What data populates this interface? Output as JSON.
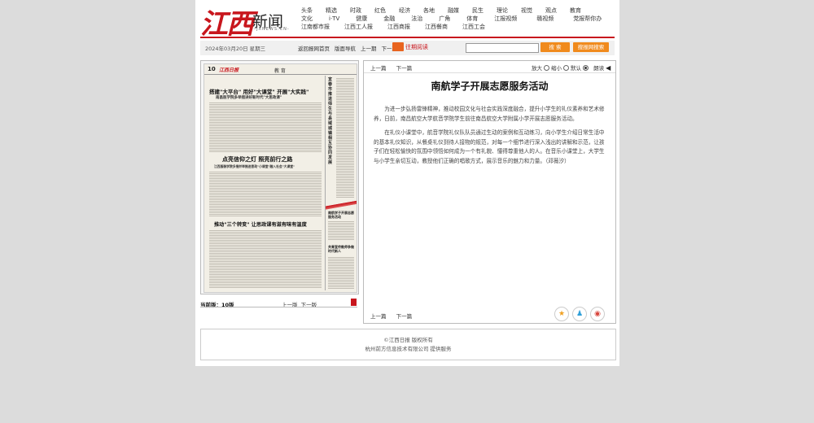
{
  "logo": {
    "cn": "江西",
    "xw": "新闻",
    "url": "-JXNEWS.CN-"
  },
  "nav": {
    "row1": [
      "头条",
      "精选",
      "时政",
      "红色",
      "经济",
      "各地",
      "融媒",
      "民生",
      "理论",
      "视觉",
      "观点",
      "教育"
    ],
    "row2": [
      "文化",
      "i·TV",
      "健康",
      "金融",
      "法治",
      "广角",
      "体育",
      "江报视频",
      "赣视频",
      "党报帮你办"
    ],
    "row3": [
      "江南都市报",
      "江西工人报",
      "江西商报",
      "江西餐商",
      "江西工会"
    ]
  },
  "toolbar": {
    "date": "2024年03月20日 星期三",
    "links": [
      "返回报网首页",
      "版面导航",
      "上一期",
      "下一期"
    ],
    "past_reading": "往期阅读",
    "search_btn": "搜 索",
    "search_site_btn": "搜报网搜索"
  },
  "paper": {
    "page_no": "10",
    "brand": "江西日报",
    "section": "教 育",
    "headline1": "搭建\"大平台\" 用好\"大课堂\" 开展\"大实践\"",
    "sub1": "南昌医学院多举措讲好新时代\"大思政课\"",
    "headline2": "点亮信仰之灯 照亮前行之路",
    "sub2": "江西服装学院多措并举推进思政\"小课堂\"融入社会\"大课堂\"",
    "headline3": "推动\"三个转变\" 让思政课有滋有味有温度",
    "vertical": "宜春市推进师生与县域城镇相互协同发展",
    "small1": "南航学子开展志愿服务活动",
    "small2": "共青宣传教师争做时代新人"
  },
  "edition": {
    "label": "当前版：",
    "value": "10版",
    "prev": "上一版",
    "next": "下一版"
  },
  "article": {
    "prev": "上一篇",
    "next": "下一篇",
    "font_label": "放大",
    "font_small": "缩小",
    "font_default": "默认",
    "read": "朗读",
    "title": "南航学子开展志愿服务活动",
    "p1": "为进一步弘扬雷锋精神，推动校园文化与社会实践深度融合，提升小学生的礼仪素养和艺术修养，日前，南昌航空大学航音学院学生前往南昌航空大学附属小学开展志愿服务活动。",
    "p2": "在礼仪小课堂中，航音学院礼仪队队员通过生动的案例和互动练习，向小学生介绍日常生活中的基本礼仪知识，从餐桌礼仪到待人接物的规范，对每一个细节进行深入浅出的讲解和示范，让孩子们在轻松愉快的氛围中领悟如何成为一个有礼貌、懂得尊重他人的人。在音乐小课堂上，大学生与小学生亲切互动，教授他们正确的唱歌方式，展示音乐的魅力和力量。（邓薇汐）"
  },
  "footer": {
    "line1": "©江西日报 版权所有",
    "line2": "杭州前方信息技术有限公司  提供服务"
  }
}
